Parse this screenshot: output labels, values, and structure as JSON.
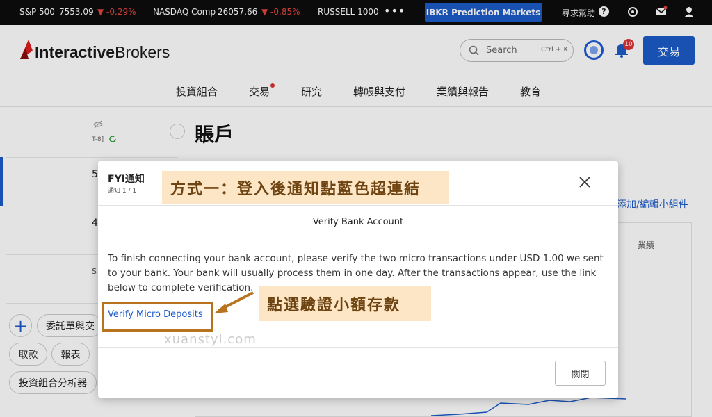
{
  "ticker": {
    "items": [
      {
        "name": "S&P 500",
        "value": "7553.09",
        "change": "▼ -0.29%"
      },
      {
        "name": "NASDAQ Comp",
        "value": "26057.66",
        "change": "▼ -0.85%"
      },
      {
        "name": "RUSSELL 1000",
        "value": "",
        "change": ""
      }
    ],
    "more": "•••",
    "prediction_button": "IBKR Prediction Markets",
    "help_label": "尋求幫助",
    "help_icon": "question-icon"
  },
  "header": {
    "logo_bold": "Interactive",
    "logo_normal": "Brokers",
    "search_placeholder": "Search",
    "search_shortcut": "Ctrl + K",
    "notification_count": "10",
    "trade_button": "交易"
  },
  "nav": [
    "投資組合",
    "交易",
    "研究",
    "轉帳與支付",
    "業績與報告",
    "教育"
  ],
  "sidebar": {
    "id_fragment": "T-8]",
    "fragment_5": "5",
    "fragment_4": "4",
    "fragment_s": "S",
    "pills": [
      "委託單與交",
      "取款",
      "報表",
      "投資組合分析器"
    ]
  },
  "main": {
    "title": "賬戶",
    "widgets_link": "添加/編輯小組件",
    "performance_label": "業績"
  },
  "modal": {
    "title": "FYI通知",
    "subtitle": "通知 1 / 1",
    "heading": "Verify Bank Account",
    "body": "To finish connecting your bank account, please verify the two micro transactions under USD 1.00 we sent to your bank. Your bank will usually process them in one day. After the transactions appear, use the link below to complete verification.",
    "link": "Verify Micro Deposits",
    "close_button": "關閉"
  },
  "annotations": {
    "method_one": "方式一：登入後通知點藍色超連結",
    "click_verify": "點選驗證小額存款",
    "watermark": "xuanstyl.com"
  },
  "colors": {
    "brand_blue": "#1d5bc9",
    "negative_red": "#e0463d",
    "annotation_bg": "#fce2bb",
    "annotation_border": "#b8731f"
  }
}
